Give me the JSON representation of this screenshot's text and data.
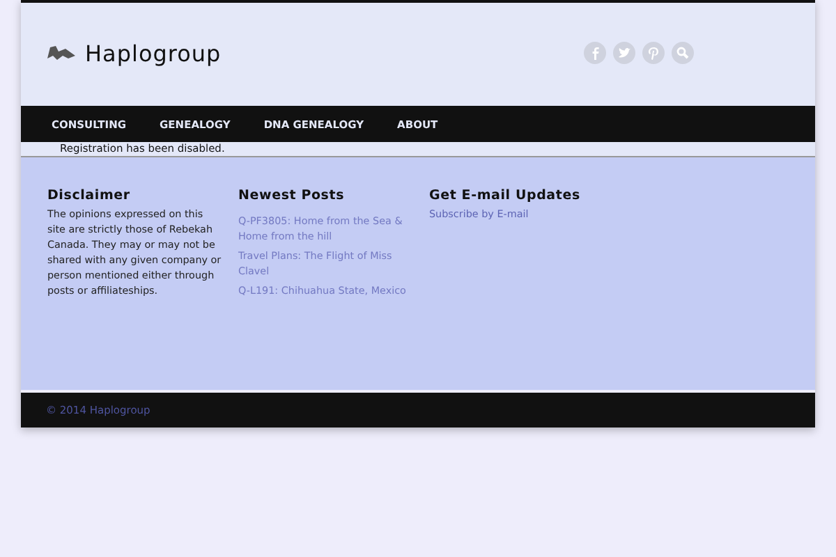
{
  "site": {
    "title": "Haplogroup"
  },
  "nav": [
    {
      "label": "CONSULTING"
    },
    {
      "label": "GENEALOGY"
    },
    {
      "label": "DNA GENEALOGY"
    },
    {
      "label": "ABOUT"
    }
  ],
  "notice": "Registration has been disabled.",
  "widgets": [
    {
      "kind": "text",
      "title": "Disclaimer",
      "text": "The opinions expressed on this site are strictly those of Rebekah Canada. They may or may not be shared with any given company or person mentioned either through posts or affiliateships."
    },
    {
      "kind": "links",
      "title": "Newest Posts",
      "links": [
        "Q-PF3805: Home from the Sea & Home from the hill",
        "Travel Plans: The Flight of Miss Clavel",
        "Q-L191: Chihuahua State, Mexico"
      ]
    },
    {
      "kind": "subscribe",
      "title": "Get E-mail Updates",
      "link": "Subscribe by E-mail"
    }
  ],
  "footer": "© 2014 Haplogroup"
}
